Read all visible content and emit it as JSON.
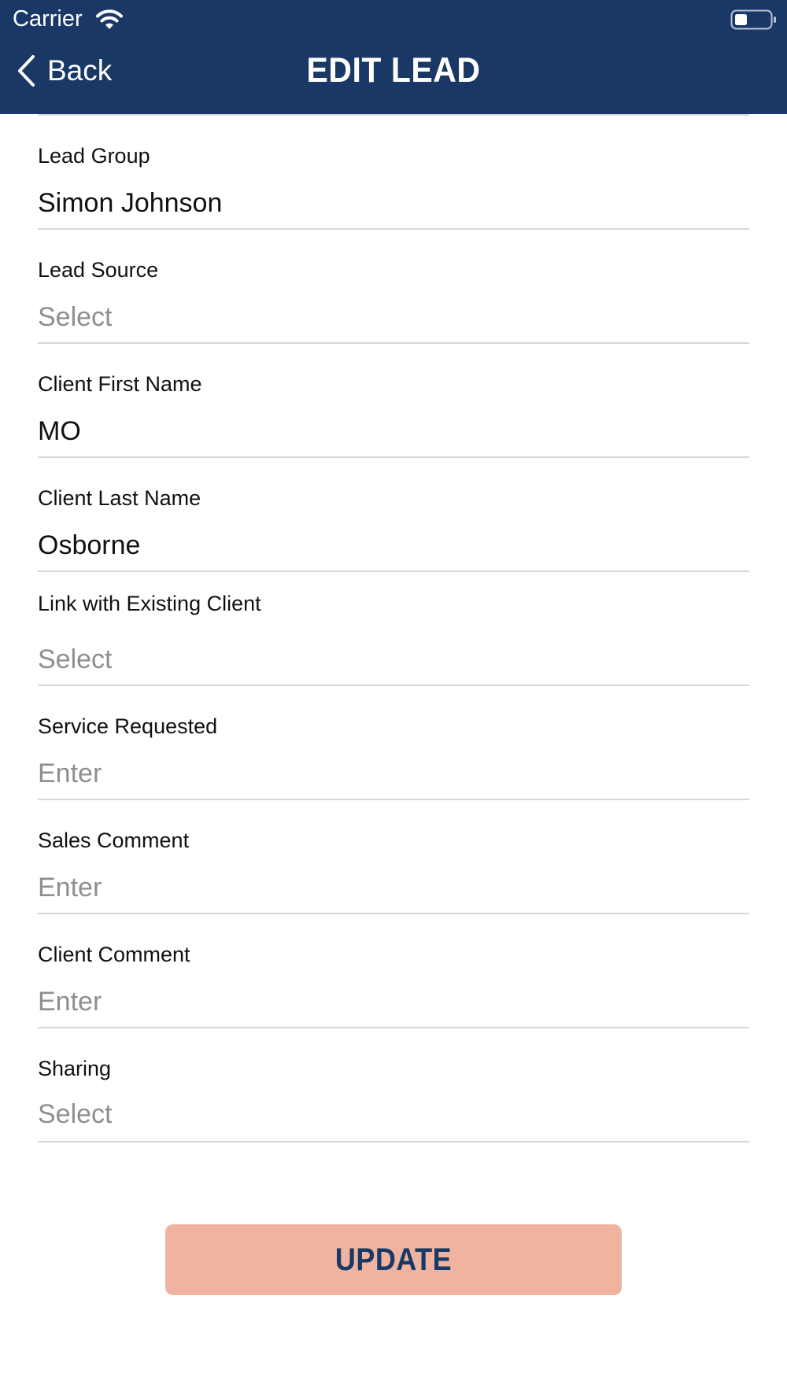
{
  "status_bar": {
    "carrier": "Carrier",
    "wifi_icon": "wifi-icon",
    "battery_icon": "battery-icon"
  },
  "header": {
    "back_label": "Back",
    "title": "EDIT LEAD",
    "back_icon": "chevron-left-icon"
  },
  "fields": [
    {
      "label": "Lead Group",
      "value": "Simon Johnson",
      "placeholder": false
    },
    {
      "label": "Lead Source",
      "value": "Select",
      "placeholder": true
    },
    {
      "label": "Client First Name",
      "value": "MO",
      "placeholder": false
    },
    {
      "label": "Client Last Name",
      "value": "Osborne",
      "placeholder": false
    },
    {
      "label": "Link with Existing Client",
      "value": "Select",
      "placeholder": true
    },
    {
      "label": "Service Requested",
      "value": "Enter",
      "placeholder": true
    },
    {
      "label": "Sales Comment",
      "value": "Enter",
      "placeholder": true
    },
    {
      "label": "Client Comment",
      "value": "Enter",
      "placeholder": true
    },
    {
      "label": "Sharing",
      "value": "Select",
      "placeholder": true
    }
  ],
  "update_label": "UPDATE",
  "colors": {
    "header_bg": "#1a3866",
    "button_bg": "#efb39f",
    "placeholder": "#8e8e93"
  }
}
